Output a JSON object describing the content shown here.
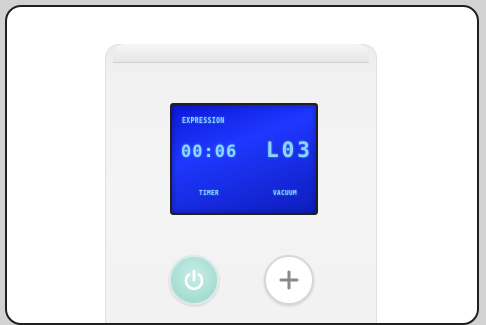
{
  "display": {
    "mode_label": "EXPRESSION",
    "time": "00:06",
    "level": "L03",
    "timer_label": "TIMER",
    "vacuum_label": "VACUUM"
  },
  "buttons": {
    "power_icon": "power-icon",
    "plus_icon": "plus-icon"
  },
  "colors": {
    "screen": "#1f37ff",
    "screen_text": "#8ad8ff",
    "power_button": "#a4ddd3"
  }
}
